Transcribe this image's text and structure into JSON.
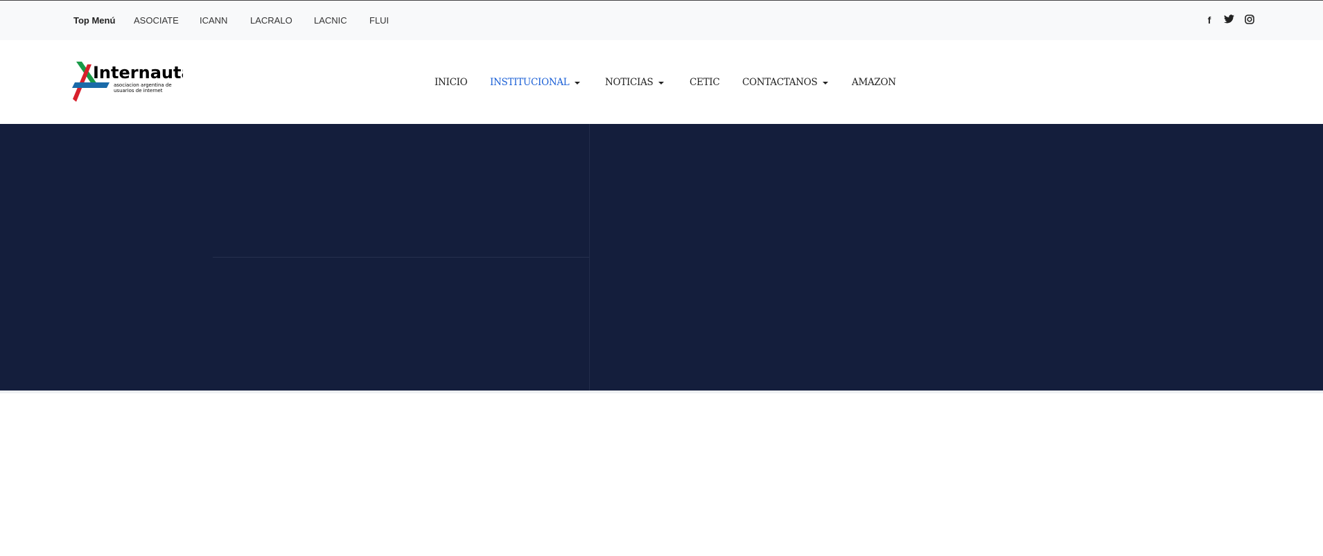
{
  "topbar": {
    "label": "Top Menú",
    "items": [
      "ASOCIATE",
      "ICANN",
      "LACRALO",
      "LACNIC",
      "FLUI"
    ],
    "social": [
      "facebook-icon",
      "twitter-icon",
      "instagram-icon"
    ]
  },
  "logo": {
    "name": "Internauta",
    "tagline1": "asociacion argentina de",
    "tagline2": "usuarios de internet"
  },
  "nav": {
    "items": [
      {
        "label": "INICIO"
      },
      {
        "label": "INSTITUCIONAL",
        "active": true
      },
      {
        "label": "NOTICIAS"
      },
      {
        "label": "CETIC"
      },
      {
        "label": "CONTACTANOS"
      },
      {
        "label": "AMAZON"
      }
    ]
  },
  "colors": {
    "accent": "#1a5fd6",
    "hero": "#141e3c"
  }
}
